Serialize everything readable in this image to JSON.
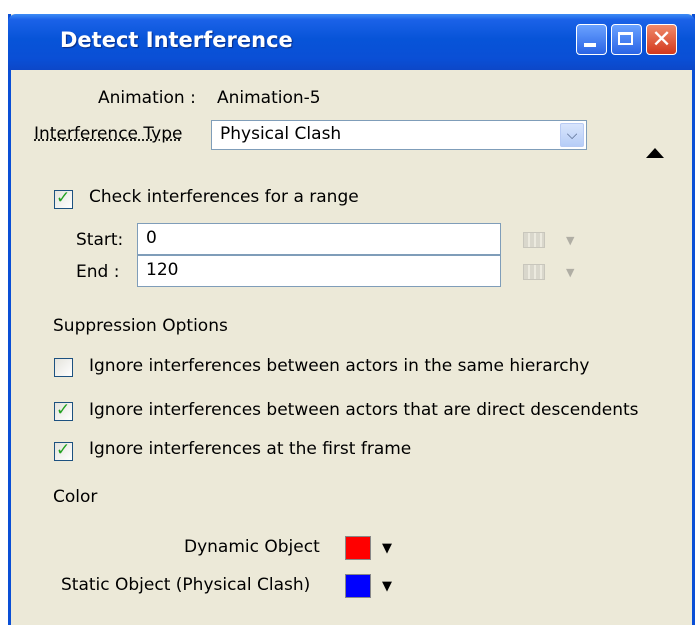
{
  "window": {
    "title": "Detect Interference"
  },
  "animation": {
    "label": "Animation :",
    "value": "Animation-5"
  },
  "interference_type": {
    "label": "Interference Type",
    "selected": "Physical Clash"
  },
  "range": {
    "checkbox_label": "Check interferences for a range",
    "checked": true,
    "start_label": "Start:",
    "start_value": "0",
    "end_label": "End :",
    "end_value": "120"
  },
  "suppression": {
    "heading": "Suppression Options",
    "options": [
      {
        "label": "Ignore interferences between actors in the same hierarchy",
        "checked": false
      },
      {
        "label": "Ignore interferences between actors that are direct descendents",
        "checked": true
      },
      {
        "label": "Ignore interferences at the first frame",
        "checked": true
      }
    ]
  },
  "color": {
    "heading": "Color",
    "dynamic": {
      "label": "Dynamic Object",
      "color": "#ff0000"
    },
    "static": {
      "label": "Static Object (Physical Clash)",
      "color": "#0000ff"
    }
  }
}
